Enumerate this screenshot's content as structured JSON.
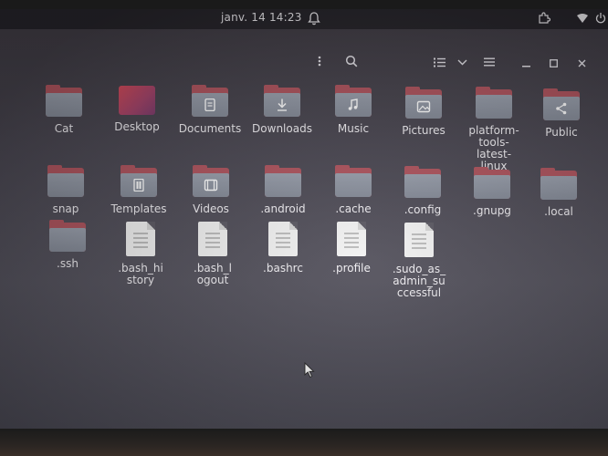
{
  "topbar": {
    "clock": "janv. 14  14:23"
  },
  "icons": {
    "bell": "bell-icon",
    "extensions": "puzzle-icon",
    "wifi": "wifi-icon",
    "power": "power-icon"
  },
  "files": [
    {
      "name": "Cat",
      "kind": "folder"
    },
    {
      "name": "Desktop",
      "kind": "desktop"
    },
    {
      "name": "Documents",
      "kind": "folder",
      "emblem": "document-emblem-icon"
    },
    {
      "name": "Downloads",
      "kind": "folder",
      "emblem": "download-emblem-icon"
    },
    {
      "name": "Music",
      "kind": "folder",
      "emblem": "music-emblem-icon"
    },
    {
      "name": "Pictures",
      "kind": "folder",
      "emblem": "picture-emblem-icon"
    },
    {
      "name": "platform-tools-latest-linux",
      "kind": "folder"
    },
    {
      "name": "Public",
      "kind": "folder",
      "emblem": "share-emblem-icon"
    },
    {
      "name": "snap",
      "kind": "folder"
    },
    {
      "name": "Templates",
      "kind": "folder",
      "emblem": "template-emblem-icon"
    },
    {
      "name": "Videos",
      "kind": "folder",
      "emblem": "video-emblem-icon"
    },
    {
      "name": ".android",
      "kind": "folder"
    },
    {
      "name": ".cache",
      "kind": "folder"
    },
    {
      "name": ".config",
      "kind": "folder"
    },
    {
      "name": ".gnupg",
      "kind": "folder"
    },
    {
      "name": ".local",
      "kind": "folder"
    },
    {
      "name": ".ssh",
      "kind": "folder"
    },
    {
      "name": ".bash_history",
      "kind": "file"
    },
    {
      "name": ".bash_logout",
      "kind": "file"
    },
    {
      "name": ".bashrc",
      "kind": "file"
    },
    {
      "name": ".profile",
      "kind": "file"
    },
    {
      "name": ".sudo_as_admin_successful",
      "kind": "file"
    }
  ],
  "colors": {
    "folder_tab": "#b0545e",
    "folder_front": "#9aa0ad",
    "topbar": "#26242a"
  }
}
